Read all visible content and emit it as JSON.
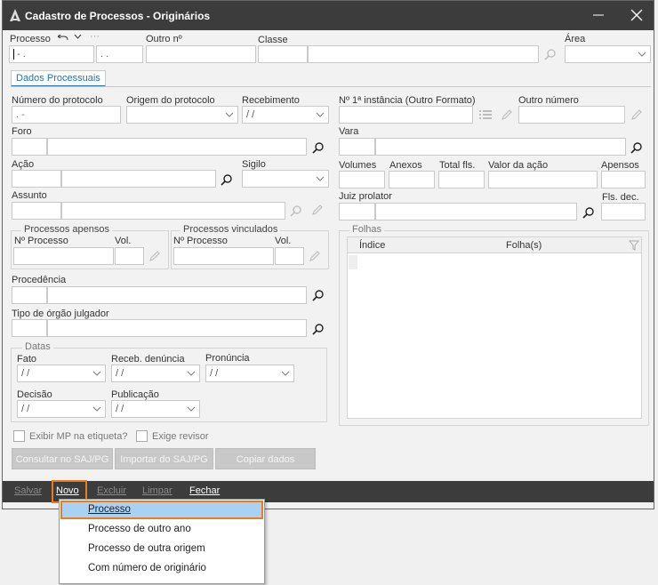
{
  "window": {
    "title": "Cadastro de Processos - Originários"
  },
  "header": {
    "processo_label": "Processo",
    "processo_value": "-  .",
    "processo_value2": ". .",
    "outro_label": "Outro nº",
    "classe_label": "Classe",
    "area_label": "Área"
  },
  "tabs": [
    {
      "label": "Dados Processuais",
      "active": true
    }
  ],
  "left": {
    "numero_protocolo_label": "Número do protocolo",
    "numero_protocolo_value": ".       -",
    "origem_protocolo_label": "Origem do protocolo",
    "recebimento_label": "Recebimento",
    "recebimento_value": "/  /",
    "foro_label": "Foro",
    "acao_label": "Ação",
    "sigilo_label": "Sigilo",
    "assunto_label": "Assunto",
    "processos_apensos_title": "Processos apensos",
    "processos_vinculados_title": "Processos vinculados",
    "nprocesso_label": "Nº Processo",
    "vol_label": "Vol.",
    "procedencia_label": "Procedência",
    "tipo_orgao_label": "Tipo de órgão julgador",
    "datas_title": "Datas",
    "fato_label": "Fato",
    "receb_denuncia_label": "Receb. denúncia",
    "pronuncia_label": "Pronúncia",
    "decisao_label": "Decisão",
    "publicacao_label": "Publicação",
    "date_placeholder": "/  /",
    "exibir_mp_label": "Exibir MP na etiqueta?",
    "exige_revisor_label": "Exige revisor",
    "consultar_button": "Consultar no SAJ/PG",
    "importar_button": "Importar do SAJ/PG",
    "copiar_button": "Copiar dados"
  },
  "right": {
    "n_primeira_instancia_label": "Nº 1ª instância (Outro Formato)",
    "outro_numero_label": "Outro número",
    "vara_label": "Vara",
    "volumes_label": "Volumes",
    "anexos_label": "Anexos",
    "total_fls_label": "Total fls.",
    "valor_acao_label": "Valor da ação",
    "apensos_label": "Apensos",
    "juiz_prolator_label": "Juiz prolator",
    "fls_dec_label": "Fls. dec.",
    "folhas_title": "Folhas",
    "indice_col": "Índice",
    "folhas_col": "Folha(s)"
  },
  "toolbar": {
    "salvar": "Salvar",
    "novo": "Novo",
    "excluir": "Excluir",
    "limpar": "Limpar",
    "fechar": "Fechar"
  },
  "novo_menu": {
    "items": [
      {
        "label": "Processo",
        "selected": true
      },
      {
        "label": "Processo de outro ano",
        "selected": false
      },
      {
        "label": "Processo de outra origem",
        "selected": false
      },
      {
        "label": "Com número de originário",
        "selected": false
      }
    ]
  },
  "icons": {
    "search": "search-icon",
    "edit": "pencil-icon",
    "list": "list-icon",
    "filter": "filter-icon",
    "undo": "undo-icon",
    "chevron": "chevron-down-icon",
    "minimize": "minimize-icon",
    "close": "close-icon"
  },
  "colors": {
    "accent": "#1e73be",
    "highlight": "#e87c1e",
    "menu_selection": "#a9d1f3",
    "titlebar": "#3c3c3c"
  }
}
